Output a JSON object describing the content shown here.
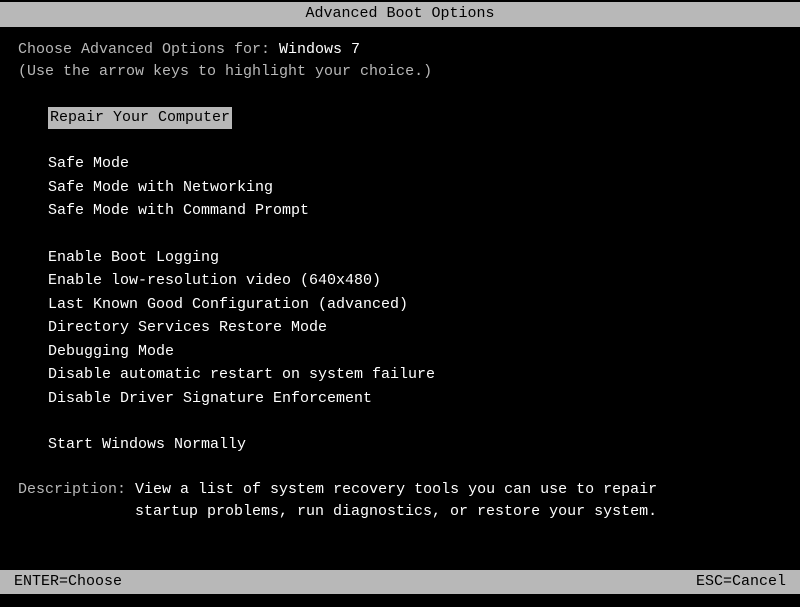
{
  "title": "Advanced Boot Options",
  "intro": {
    "prefix": "Choose Advanced Options for: ",
    "os": "Windows 7"
  },
  "instruction": "(Use the arrow keys to highlight your choice.)",
  "menu": {
    "group1": [
      "Repair Your Computer"
    ],
    "group2": [
      "Safe Mode",
      "Safe Mode with Networking",
      "Safe Mode with Command Prompt"
    ],
    "group3": [
      "Enable Boot Logging",
      "Enable low-resolution video (640x480)",
      "Last Known Good Configuration (advanced)",
      "Directory Services Restore Mode",
      "Debugging Mode",
      "Disable automatic restart on system failure",
      "Disable Driver Signature Enforcement"
    ],
    "group4": [
      "Start Windows Normally"
    ]
  },
  "description": {
    "label": "Description: ",
    "line1": "View a list of system recovery tools you can use to repair",
    "line2": "startup problems, run diagnostics, or restore your system."
  },
  "footer": {
    "left": "ENTER=Choose",
    "right": "ESC=Cancel"
  }
}
